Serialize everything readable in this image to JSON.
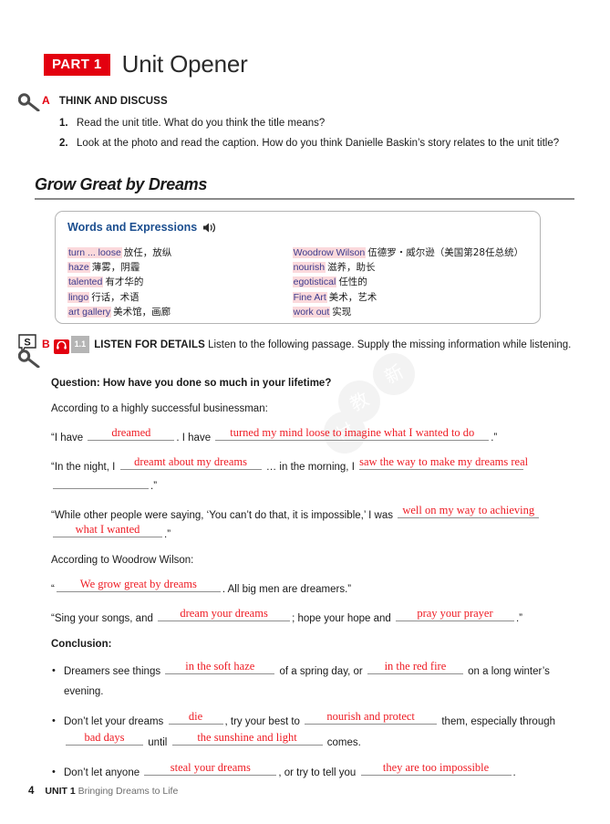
{
  "part": {
    "badge": "PART 1",
    "title": "Unit Opener"
  },
  "colors": {
    "brand_red": "#e3000f",
    "answer_red": "#ee1c24",
    "vocab_heading_blue": "#1b4e8f",
    "term_highlight": "#fbd9dc"
  },
  "exercise_a": {
    "letter": "A",
    "title": "THINK AND DISCUSS",
    "items": [
      {
        "num": "1.",
        "text": "Read the unit title. What do you think the title means?"
      },
      {
        "num": "2.",
        "text": "Look at the photo and read the caption. How do you think Danielle Baskin’s story relates to the unit title?"
      }
    ]
  },
  "unit_heading": "Grow Great by Dreams",
  "vocab": {
    "heading": "Words and Expressions",
    "audio_icon": "speaker-icon",
    "left": [
      {
        "term": "turn ... loose",
        "gloss": "放任，放纵"
      },
      {
        "term": "haze",
        "gloss": "薄雾，阴霾"
      },
      {
        "term": "talented",
        "gloss": "有才华的"
      },
      {
        "term": "lingo",
        "gloss": "行话，术语"
      },
      {
        "term": "art gallery",
        "gloss": "美术馆，画廊"
      }
    ],
    "right": [
      {
        "term": "Woodrow Wilson",
        "gloss": "伍德罗・威尔逊（美国第28任总统）"
      },
      {
        "term": "nourish",
        "gloss": "滋养，助长"
      },
      {
        "term": "egotistical",
        "gloss": "任性的"
      },
      {
        "term": "Fine Art",
        "gloss": "美术，艺术"
      },
      {
        "term": "work out",
        "gloss": "实现"
      }
    ]
  },
  "exercise_b": {
    "skill_badge": "S",
    "letter": "B",
    "headphone_icon": "headphone-icon",
    "track": "1.1",
    "title": "LISTEN FOR DETAILS",
    "instruction": "Listen to the following passage. Supply the missing information while listening.",
    "question": "Question: How have you done so much in your lifetime?",
    "intro_businessman": "According to a highly successful businessman:",
    "quote1": {
      "pre": "“I have",
      "answer1": "dreamed",
      "mid": ". I have",
      "answer2": "turned my mind loose to imagine what I wanted to do",
      "post": ".”"
    },
    "quote2": {
      "pre": "“In the night, I",
      "answer1": "dreamt about my dreams",
      "mid": "… in the morning, I",
      "answer2": "saw the way to make my dreams real",
      "post": ".”"
    },
    "quote3": {
      "pre": "“While other people were saying, ‘You can’t do that, it is impossible,’ I was",
      "answer1": "well on my way to achieving",
      "answer2": "what I wanted",
      "post": ".”"
    },
    "intro_wilson": "According to Woodrow Wilson:",
    "quote4": {
      "pre": "“",
      "answer1": "We grow great by dreams",
      "post": ". All big men are dreamers.”"
    },
    "quote5": {
      "pre": "“Sing your songs, and",
      "answer1": "dream your dreams",
      "mid": "; hope your hope and",
      "answer2": "pray your prayer",
      "post": ".”"
    },
    "conclusion_label": "Conclusion:",
    "bullets": [
      {
        "pre": "Dreamers see things",
        "answer1": "in the soft haze",
        "mid": "of a spring day, or",
        "answer2": "in the red fire",
        "post": "on a long winter’s evening."
      },
      {
        "pre": "Don’t let your dreams",
        "answer1": "die",
        "mid": ", try your best to",
        "answer2": "nourish and protect",
        "mid2": "them, especially through",
        "answer3": "bad days",
        "mid3": "until",
        "answer4": "the sunshine and light",
        "post": "comes."
      },
      {
        "pre": "Don’t let anyone",
        "answer1": "steal your dreams",
        "mid": ", or try to tell you",
        "answer2": "they are too impossible",
        "post": "."
      }
    ]
  },
  "footer": {
    "page_number": "4",
    "unit_label": "UNIT 1",
    "unit_title": "Bringing Dreams to Life"
  },
  "watermark": {
    "chars": [
      "新",
      "教",
      "材"
    ]
  }
}
